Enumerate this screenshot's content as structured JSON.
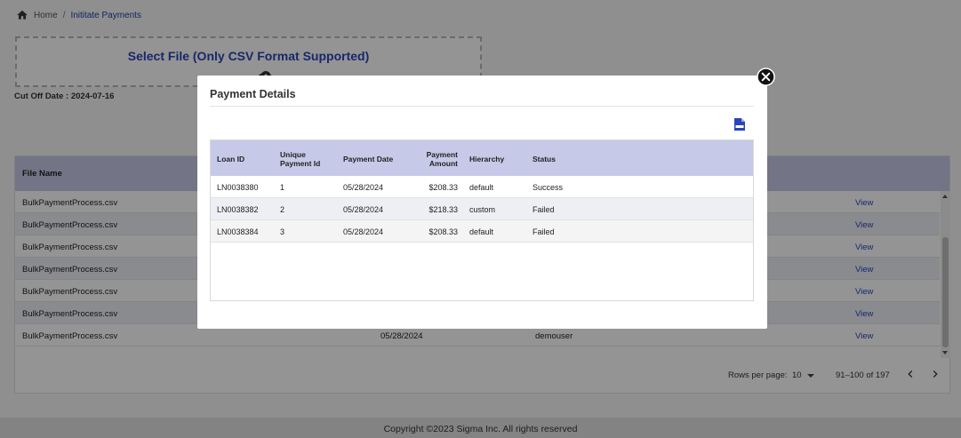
{
  "breadcrumb": {
    "home": "Home",
    "separator": "/",
    "current": "Inititate Payments"
  },
  "upload": {
    "title": "Select File (Only CSV Format Supported)",
    "icon": "upload-cloud-icon"
  },
  "cutoff_label": "Cut Off Date : 2024-07-16",
  "files_table": {
    "column_file_name": "File Name",
    "rows": [
      {
        "file": "BulkPaymentProcess.csv",
        "date": "",
        "user": "",
        "action": "View"
      },
      {
        "file": "BulkPaymentProcess.csv",
        "date": "",
        "user": "",
        "action": "View"
      },
      {
        "file": "BulkPaymentProcess.csv",
        "date": "",
        "user": "",
        "action": "View"
      },
      {
        "file": "BulkPaymentProcess.csv",
        "date": "",
        "user": "",
        "action": "View"
      },
      {
        "file": "BulkPaymentProcess.csv",
        "date": "",
        "user": "",
        "action": "View"
      },
      {
        "file": "BulkPaymentProcess.csv",
        "date": "",
        "user": "",
        "action": "View"
      },
      {
        "file": "BulkPaymentProcess.csv",
        "date": "05/28/2024",
        "user": "demouser",
        "action": "View"
      }
    ]
  },
  "pagination": {
    "rows_per_page_label": "Rows per page:",
    "rows_per_page": "10",
    "range": "91–100 of 197"
  },
  "footer": "Copyright ©2023 Sigma Inc. All rights reserved",
  "modal": {
    "title": "Payment Details",
    "columns": {
      "loan_id": "Loan ID",
      "unique_payment_id_1": "Unique",
      "unique_payment_id_2": "Payment Id",
      "payment_date": "Payment Date",
      "payment_amount_1": "Payment",
      "payment_amount_2": "Amount",
      "hierarchy": "Hierarchy",
      "status": "Status"
    },
    "rows": [
      {
        "loan_id": "LN0038380",
        "uid": "1",
        "date": "05/28/2024",
        "amount": "$208.33",
        "hierarchy": "default",
        "status": "Success"
      },
      {
        "loan_id": "LN0038382",
        "uid": "2",
        "date": "05/28/2024",
        "amount": "$218.33",
        "hierarchy": "custom",
        "status": "Failed"
      },
      {
        "loan_id": "LN0038384",
        "uid": "3",
        "date": "05/28/2024",
        "amount": "$208.33",
        "hierarchy": "default",
        "status": "Failed"
      }
    ]
  },
  "colors": {
    "accent": "#2a45b8",
    "header_bg": "#c6cae8",
    "overlay": "rgba(0,0,0,0.42)"
  }
}
